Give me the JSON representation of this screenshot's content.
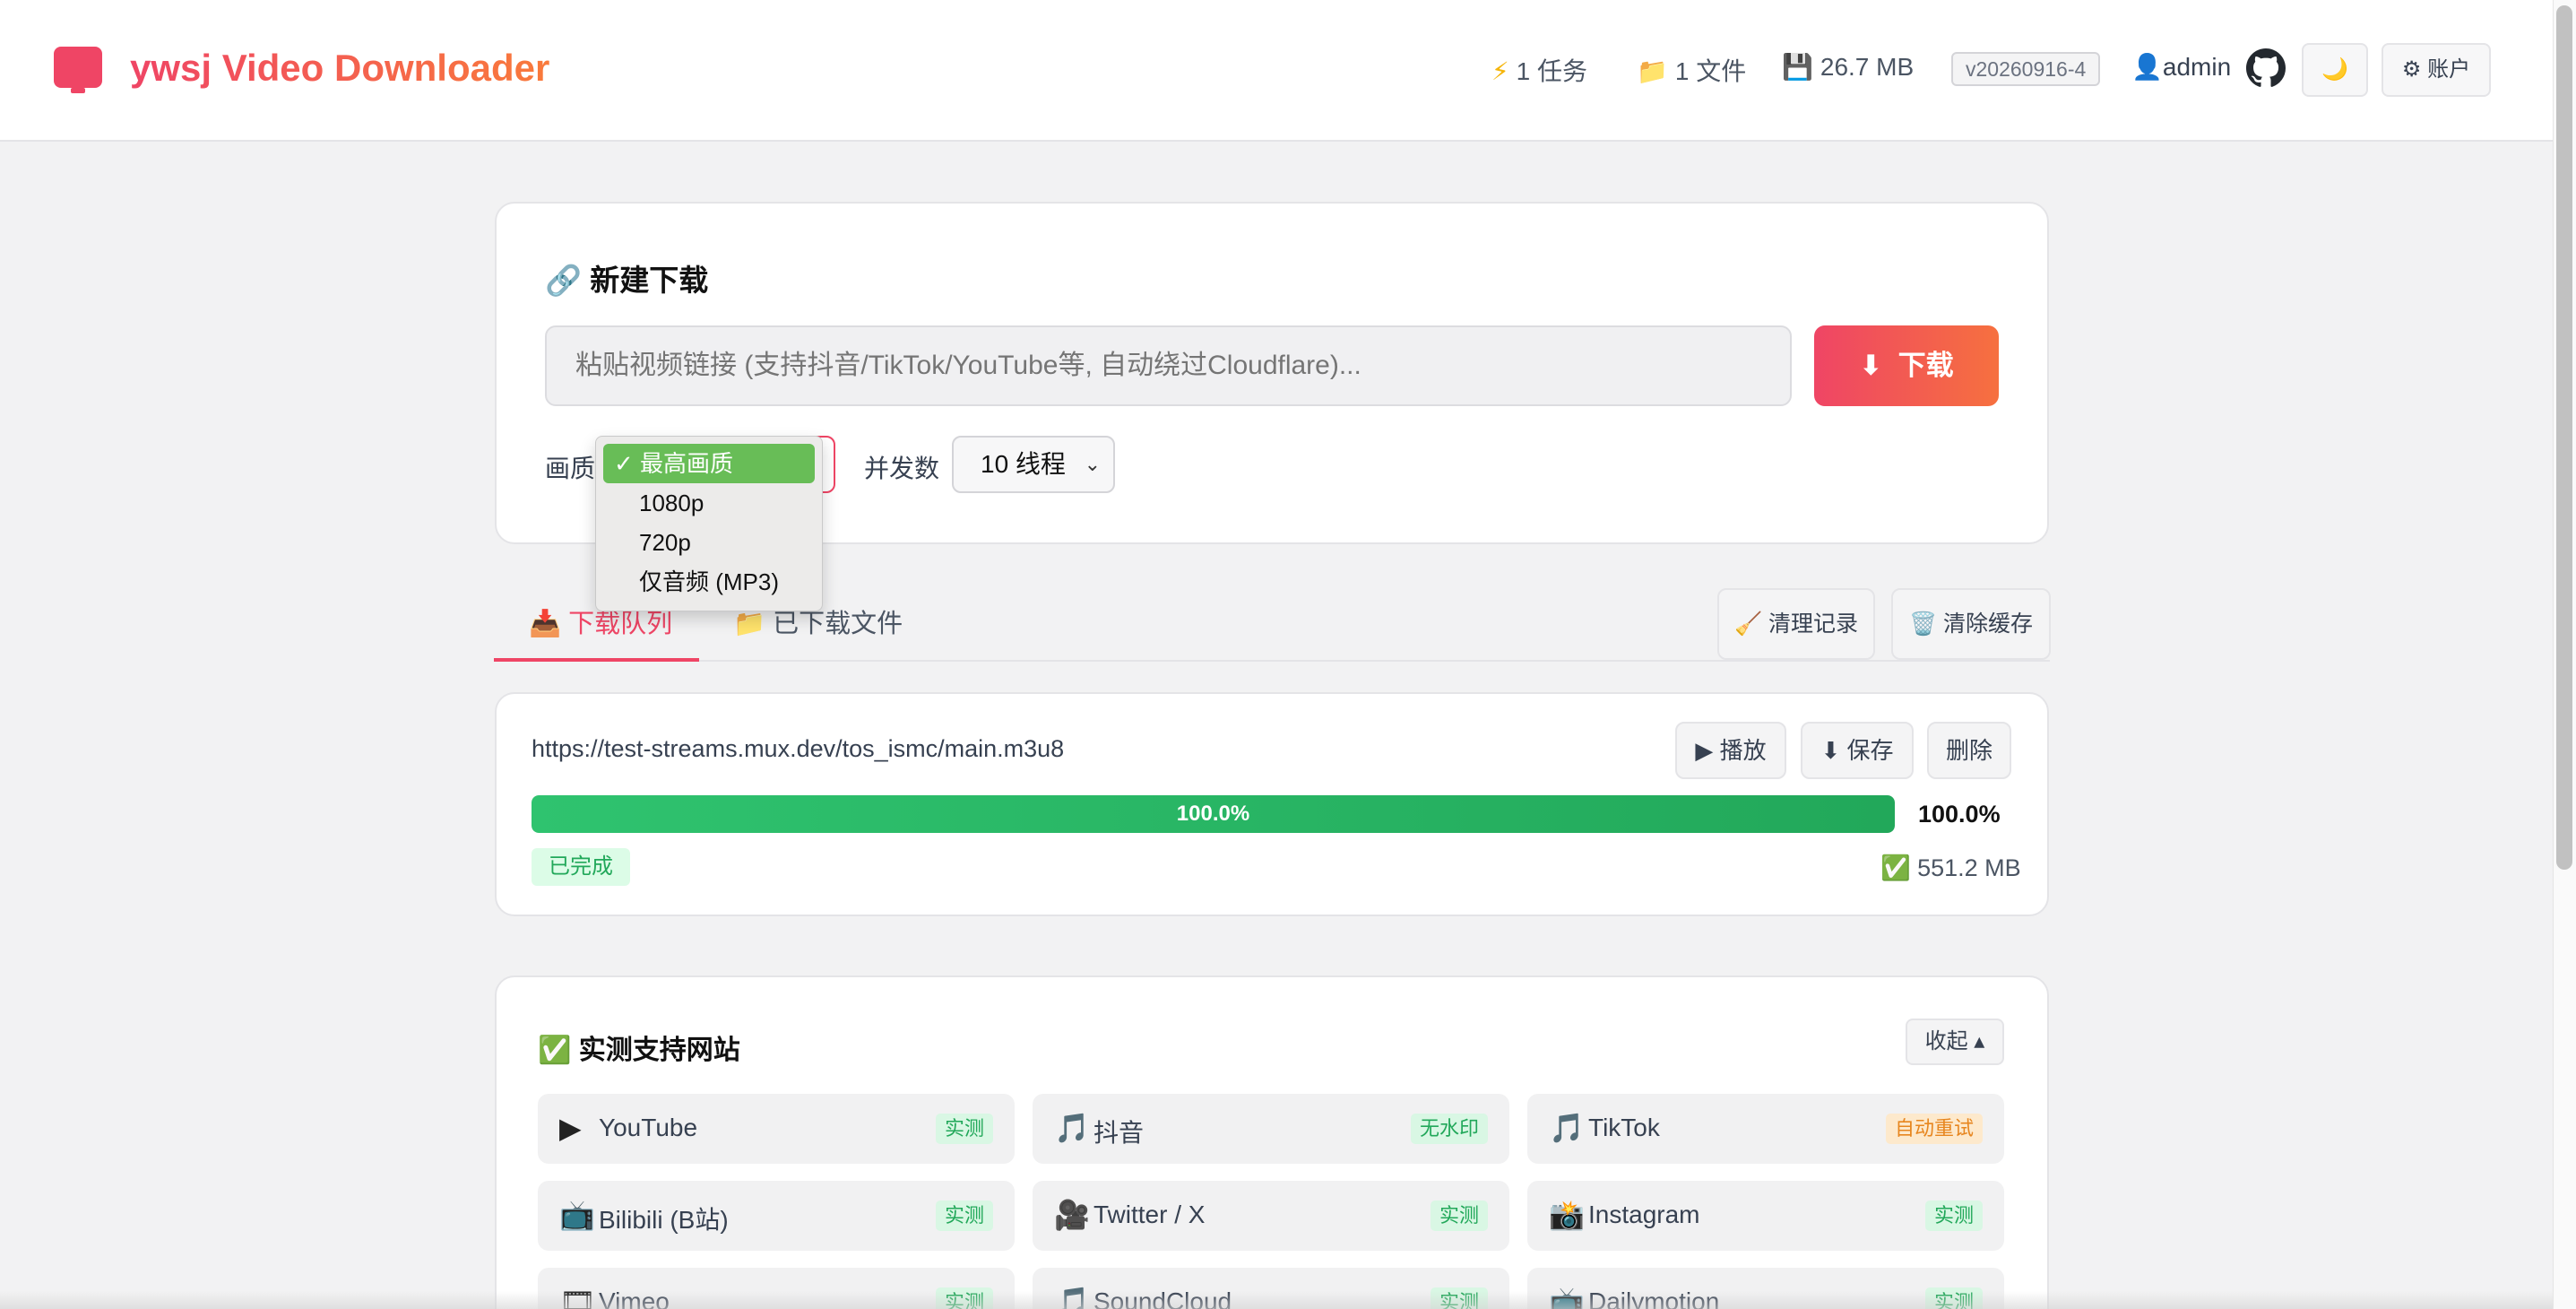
{
  "header": {
    "app_title": "ywsj Video Downloader",
    "tasks": "1 任务",
    "files": "1 文件",
    "storage": "26.7 MB",
    "version": "v20260916-4",
    "user": "admin",
    "theme_icon": "🌙",
    "account_label": "⚙ 账户"
  },
  "new_download": {
    "title": "🔗 新建下载",
    "url_placeholder": "粘贴视频链接 (支持抖音/TikTok/YouTube等, 自动绕过Cloudflare)...",
    "download_label": "下载",
    "quality_label": "画质",
    "threads_label": "并发数",
    "threads_value": "10 线程",
    "quality_options": [
      "✓ 最高画质",
      "1080p",
      "720p",
      "仅音频 (MP3)"
    ]
  },
  "tabs": {
    "queue": "📥 下载队列",
    "downloaded": "📁 已下载文件",
    "clear_records": "🧹 清理记录",
    "clear_cache": "🗑️ 清除缓存"
  },
  "task": {
    "url": "https://test-streams.mux.dev/tos_ismc/main.m3u8",
    "play": "▶ 播放",
    "save": "⬇ 保存",
    "delete": "删除",
    "progress": 1.0,
    "progress_text": "100.0%",
    "status": "已完成",
    "size": "✅ 551.2 MB"
  },
  "sites": {
    "title": "✅ 实测支持网站",
    "collapse": "收起 ▴",
    "items": [
      {
        "icon": "▶",
        "name": "YouTube",
        "badge": "实测",
        "badge_type": "green"
      },
      {
        "icon": "🎵",
        "name": "抖音",
        "badge": "无水印",
        "badge_type": "green"
      },
      {
        "icon": "🎵",
        "name": "TikTok",
        "badge": "自动重试",
        "badge_type": "orange"
      },
      {
        "icon": "📺",
        "name": "Bilibili (B站)",
        "badge": "实测",
        "badge_type": "green"
      },
      {
        "icon": "🎥",
        "name": "Twitter / X",
        "badge": "实测",
        "badge_type": "green"
      },
      {
        "icon": "📸",
        "name": "Instagram",
        "badge": "实测",
        "badge_type": "green"
      },
      {
        "icon": "🎞",
        "name": "Vimeo",
        "badge": "实测",
        "badge_type": "green"
      },
      {
        "icon": "🎵",
        "name": "SoundCloud",
        "badge": "实测",
        "badge_type": "green"
      },
      {
        "icon": "📺",
        "name": "Dailymotion",
        "badge": "实测",
        "badge_type": "green"
      }
    ]
  },
  "colors": {
    "accent": "#ef4565",
    "accent2": "#f6703f",
    "success": "#22a85a"
  }
}
